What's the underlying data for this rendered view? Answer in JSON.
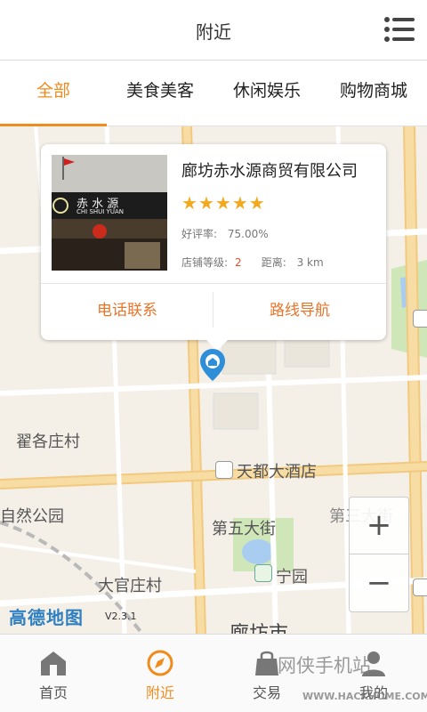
{
  "header": {
    "title": "附近"
  },
  "tabs": [
    {
      "label": "全部",
      "active": true
    },
    {
      "label": "美食美客",
      "active": false
    },
    {
      "label": "休闲娱乐",
      "active": false
    },
    {
      "label": "购物商城",
      "active": false
    }
  ],
  "card": {
    "shop_name": "廊坊赤水源商贸有限公司",
    "stars": 5,
    "rating_label": "好评率:",
    "rating_value": "75.00%",
    "level_label": "店铺等级:",
    "level_value": "2",
    "distance_label": "距离:",
    "distance_value": "3 km",
    "photo_sign_cn": "赤 水 源",
    "photo_sign_en": "CHI SHUI YUAN",
    "call_button": "电话联系",
    "route_button": "路线导航"
  },
  "map": {
    "labels": [
      {
        "id": "dizhuang",
        "text": "翟各庄村"
      },
      {
        "id": "hotel",
        "text": "天都大酒店"
      },
      {
        "id": "park",
        "text": "自然公园"
      },
      {
        "id": "street5",
        "text": "第五大街"
      },
      {
        "id": "street3",
        "text": "第三大街"
      },
      {
        "id": "ningyuan",
        "text": "宁园"
      },
      {
        "id": "daguan",
        "text": "大官庄村"
      },
      {
        "id": "city",
        "text": "廊坊市"
      }
    ],
    "logo": "高德地图",
    "version": "V2.3.1",
    "zoom_in": "+",
    "zoom_out": "−"
  },
  "bottom_nav": [
    {
      "label": "首页",
      "icon": "home-icon",
      "active": false
    },
    {
      "label": "附近",
      "icon": "compass-icon",
      "active": true
    },
    {
      "label": "交易",
      "icon": "bag-icon",
      "active": false
    },
    {
      "label": "我的",
      "icon": "user-icon",
      "active": false
    }
  ],
  "watermark": {
    "text": "网侠手机站",
    "url": "WWW.HACKHOME.COM"
  },
  "colors": {
    "accent": "#f08c1e",
    "link": "#e8742a",
    "star": "#f2a91f",
    "level": "#e64b2b"
  }
}
